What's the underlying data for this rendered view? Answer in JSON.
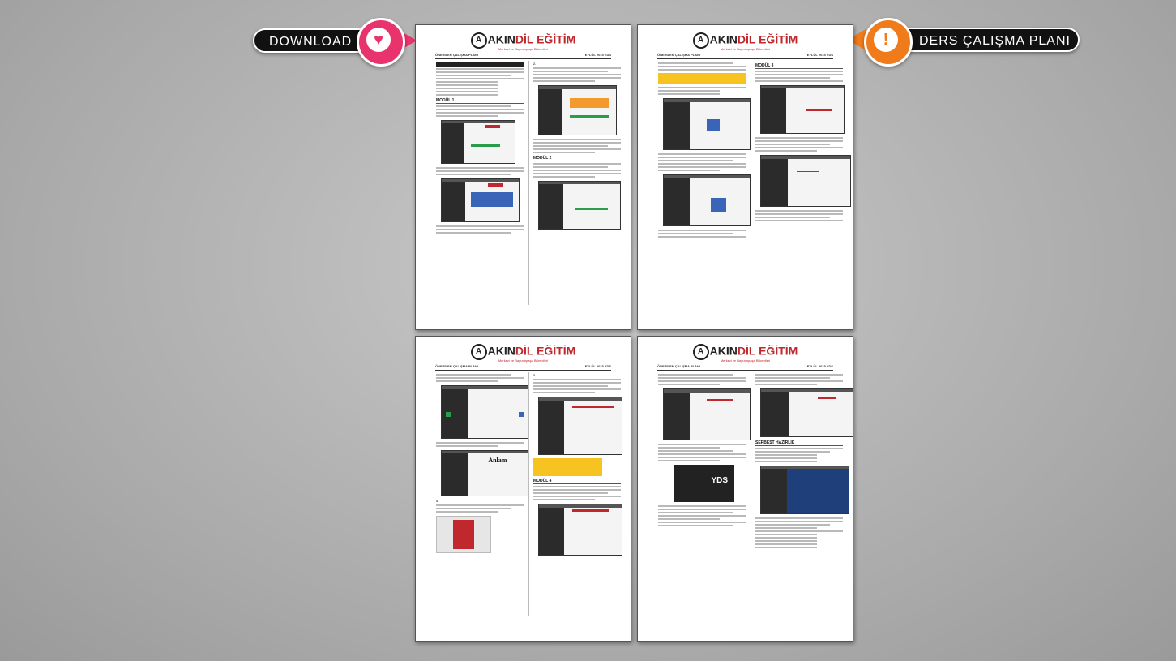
{
  "left_badge": {
    "label": "DOWNLOAD",
    "icon": "heart-icon",
    "color": "#e8336d"
  },
  "right_badge": {
    "label": "DERS ÇALIŞMA PLANI",
    "icon": "exclamation-icon",
    "color": "#f07b1a"
  },
  "brand": {
    "name_dark": "AKIN",
    "name_red": "DİL EĞİTİM",
    "tagline": "Merkezi ve Bayrampaşa Bilkentleri"
  },
  "pages": [
    {
      "header_left": "ÖNERİLEN ÇALIŞMA PLANI",
      "header_right": "EYLÜL 2015 YDS",
      "left_headings": [
        "MODÜL 1"
      ],
      "right_headings": [
        "MODÜL 2"
      ]
    },
    {
      "header_left": "ÖNERİLEN ÇALIŞMA PLANI",
      "header_right": "EYLÜL 2015 YDS",
      "left_headings": [],
      "right_headings": [
        "MODÜL 3"
      ]
    },
    {
      "header_left": "ÖNERİLEN ÇALIŞMA PLANI",
      "header_right": "EYLÜL 2015 YDS",
      "left_headings": [],
      "right_headings": [
        "MODÜL 4"
      ],
      "screenshot_text": "Anlam"
    },
    {
      "header_left": "ÖNERİLEN ÇALIŞMA PLANI",
      "header_right": "EYLÜL 2015 YDS",
      "left_headings": [],
      "right_headings": [
        "SERBEST HAZIRLIK"
      ],
      "book_text": "YDS"
    }
  ]
}
